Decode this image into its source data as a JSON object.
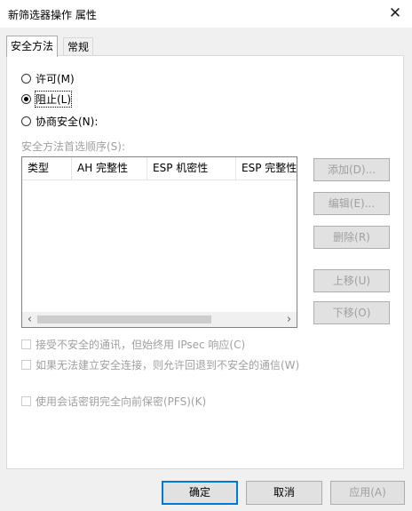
{
  "window": {
    "title": "新筛选器操作 属性",
    "close_glyph": "✕"
  },
  "tabs": [
    {
      "label": "安全方法"
    },
    {
      "label": "常规"
    }
  ],
  "actions": {
    "permit": "许可(M)",
    "block": "阻止(L)",
    "negotiate": "协商安全(N):",
    "selected": "block"
  },
  "methods_list": {
    "label": "安全方法首选顺序(S):",
    "columns": [
      "类型",
      "AH 完整性",
      "ESP 机密性",
      "ESP 完整性"
    ],
    "scroll_left": "‹",
    "scroll_right": "›"
  },
  "side_buttons": {
    "add": "添加(D)...",
    "edit": "编辑(E)...",
    "remove": "删除(R)",
    "move_up": "上移(U)",
    "move_down": "下移(O)"
  },
  "checkboxes": {
    "accept_unsecured": "接受不安全的通讯，但始终用 IPsec 响应(C)",
    "allow_fallback": "如果无法建立安全连接，则允许回退到不安全的通信(W)",
    "pfs": "使用会话密钥完全向前保密(PFS)(K)"
  },
  "footer": {
    "ok": "确定",
    "cancel": "取消",
    "apply": "应用(A)"
  }
}
